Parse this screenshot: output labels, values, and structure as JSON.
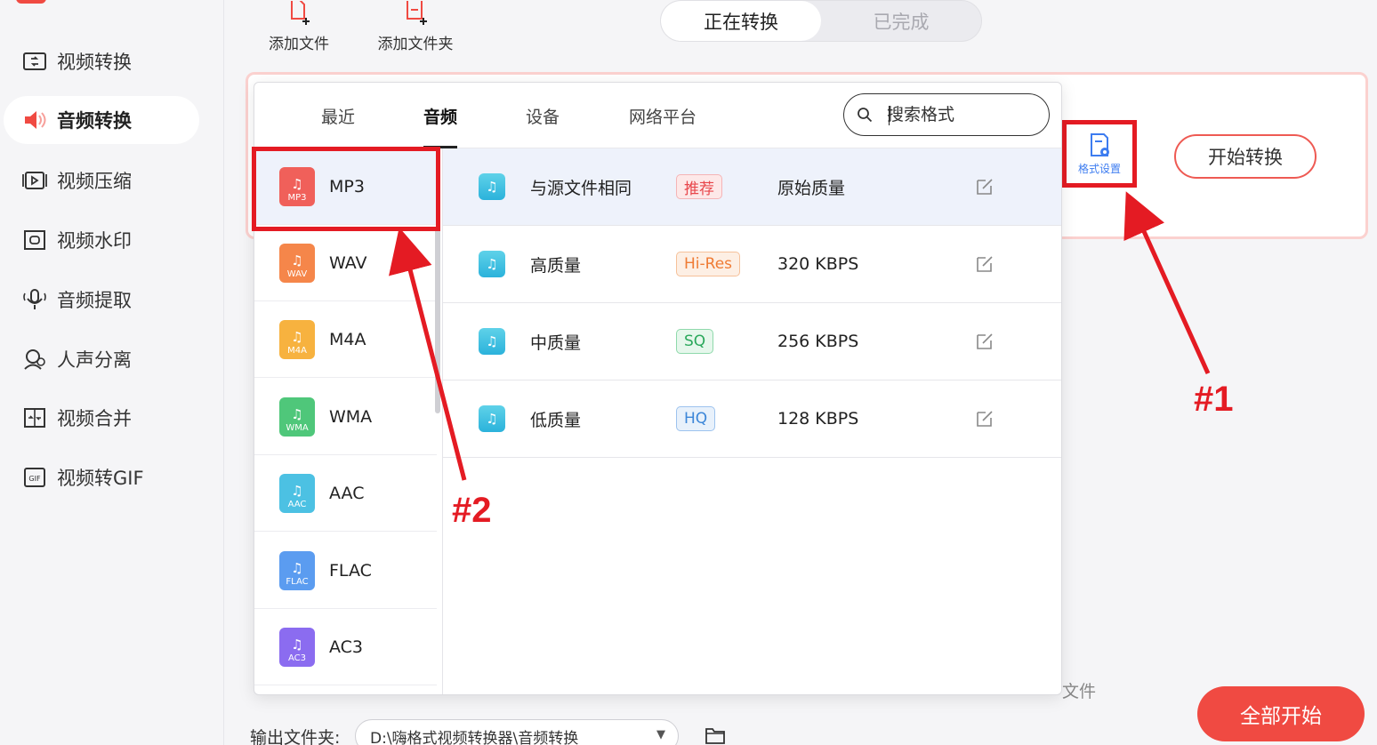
{
  "sidebar": {
    "items": [
      {
        "label": "视频转换",
        "icon": "video-convert-icon"
      },
      {
        "label": "音频转换",
        "icon": "audio-convert-icon"
      },
      {
        "label": "视频压缩",
        "icon": "video-compress-icon"
      },
      {
        "label": "视频水印",
        "icon": "video-watermark-icon"
      },
      {
        "label": "音频提取",
        "icon": "audio-extract-icon"
      },
      {
        "label": "人声分离",
        "icon": "vocal-separate-icon"
      },
      {
        "label": "视频合并",
        "icon": "video-merge-icon"
      },
      {
        "label": "视频转GIF",
        "icon": "gif-icon"
      }
    ],
    "active_index": 1
  },
  "toolbar": {
    "add_file": "添加文件",
    "add_folder": "添加文件夹"
  },
  "status_tabs": {
    "converting": "正在转换",
    "completed": "已完成"
  },
  "format_popup": {
    "tabs": [
      "最近",
      "音频",
      "设备",
      "网络平台"
    ],
    "active_tab": "音频",
    "search_placeholder": "搜索格式",
    "formats": [
      {
        "name": "MP3",
        "badge": "MP3",
        "color": "#f0605a"
      },
      {
        "name": "WAV",
        "badge": "WAV",
        "color": "#f5864a"
      },
      {
        "name": "M4A",
        "badge": "M4A",
        "color": "#f7b23f"
      },
      {
        "name": "WMA",
        "badge": "WMA",
        "color": "#4fc77a"
      },
      {
        "name": "AAC",
        "badge": "AAC",
        "color": "#4cc1e3"
      },
      {
        "name": "FLAC",
        "badge": "FLAC",
        "color": "#5b9cf0"
      },
      {
        "name": "AC3",
        "badge": "AC3",
        "color": "#8b6cf0"
      }
    ],
    "active_format": "MP3",
    "qualities": [
      {
        "name": "与源文件相同",
        "tag": "推荐",
        "rate": "原始质量"
      },
      {
        "name": "高质量",
        "tag": "Hi-Res",
        "rate": "320 KBPS"
      },
      {
        "name": "中质量",
        "tag": "SQ",
        "rate": "256 KBPS"
      },
      {
        "name": "低质量",
        "tag": "HQ",
        "rate": "128 KBPS"
      }
    ]
  },
  "task_card": {
    "format_setting": "格式设置",
    "start_convert": "开始转换",
    "file_tail": "文件"
  },
  "footer": {
    "output_label": "输出文件夹:",
    "output_path": "D:\\嗨格式视频转换器\\音频转换",
    "all_start": "全部开始"
  },
  "annotations": {
    "label1": "#1",
    "label2": "#2"
  },
  "colors": {
    "accent_red": "#f04a42",
    "annotation_red": "#e41b23",
    "link_blue": "#3d7cf0"
  }
}
